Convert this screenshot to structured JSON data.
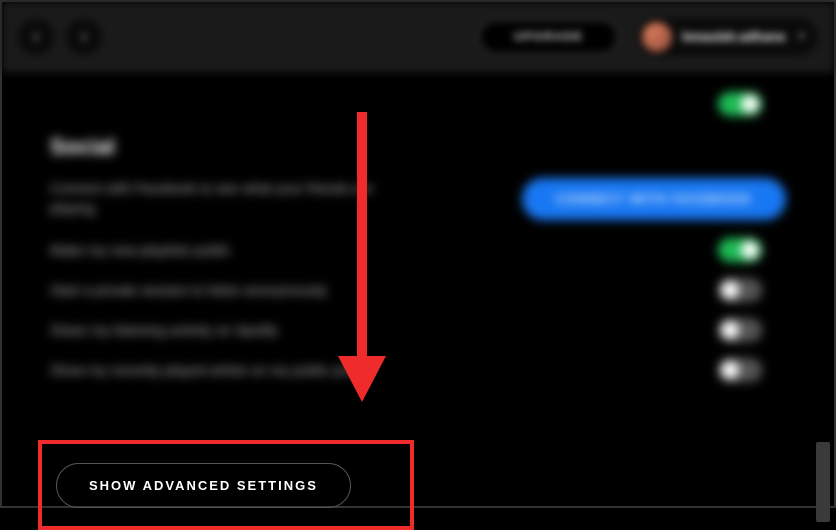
{
  "header": {
    "upgrade_label": "UPGRADE",
    "profile_name": "bmaulah.adhana"
  },
  "social": {
    "title": "Social",
    "fb_desc": "Connect with Facebook to see what your friends are playing.",
    "fb_button": "CONNECT WITH FACEBOOK",
    "rows": [
      {
        "label": "Make my new playlists public",
        "on": true
      },
      {
        "label": "Start a private session to listen anonymously",
        "on": false
      },
      {
        "label": "Share my listening activity on Spotify",
        "on": false
      },
      {
        "label": "Show my recently played artists on my public profile",
        "on": false
      }
    ]
  },
  "advanced": {
    "button_label": "SHOW ADVANCED SETTINGS"
  },
  "colors": {
    "accent_green": "#1db954",
    "facebook_blue": "#1877f2",
    "highlight_red": "#ef2b2b"
  }
}
